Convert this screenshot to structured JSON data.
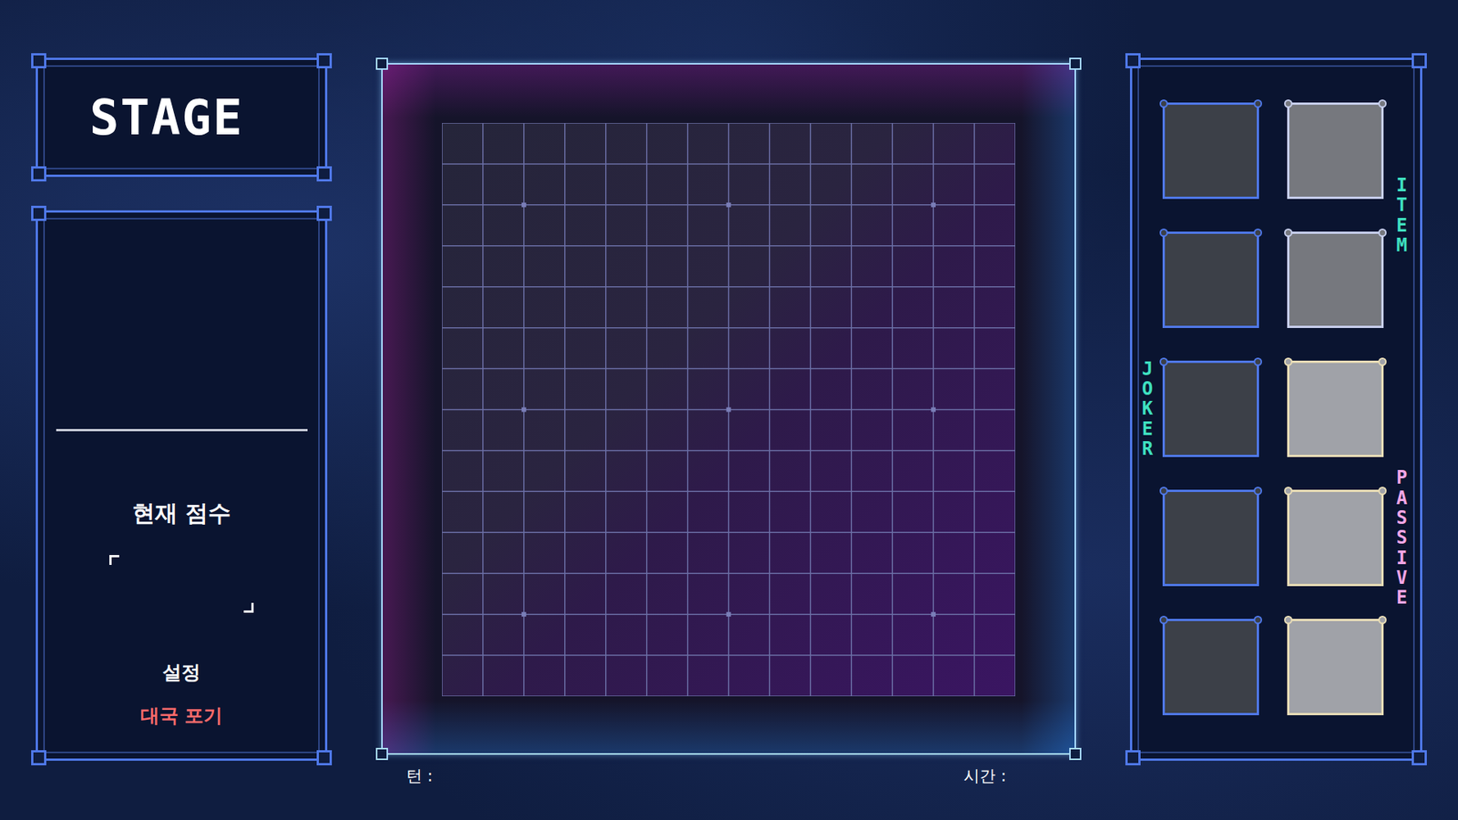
{
  "stage": {
    "title": "STAGE"
  },
  "score": {
    "label": "현재 점수"
  },
  "menu": [
    {
      "label": "설정",
      "color": "#ffffff"
    },
    {
      "label": "대국 포기",
      "color": "#ff6b6b"
    }
  ],
  "status": {
    "turn_label": "턴 :",
    "time_label": "시간 :"
  },
  "inventory": {
    "joker_label": "JOKER",
    "item_label": "ITEM",
    "passive_label": "PASSIVE",
    "joker_slots": [
      {
        "empty": true
      },
      {
        "empty": true
      },
      {
        "empty": true
      },
      {
        "empty": true
      },
      {
        "empty": true
      }
    ],
    "side_slots": [
      {
        "kind": "item",
        "empty": true
      },
      {
        "kind": "item",
        "empty": true
      },
      {
        "kind": "passive",
        "empty": true
      },
      {
        "kind": "passive",
        "empty": true
      },
      {
        "kind": "passive",
        "empty": true
      }
    ]
  }
}
